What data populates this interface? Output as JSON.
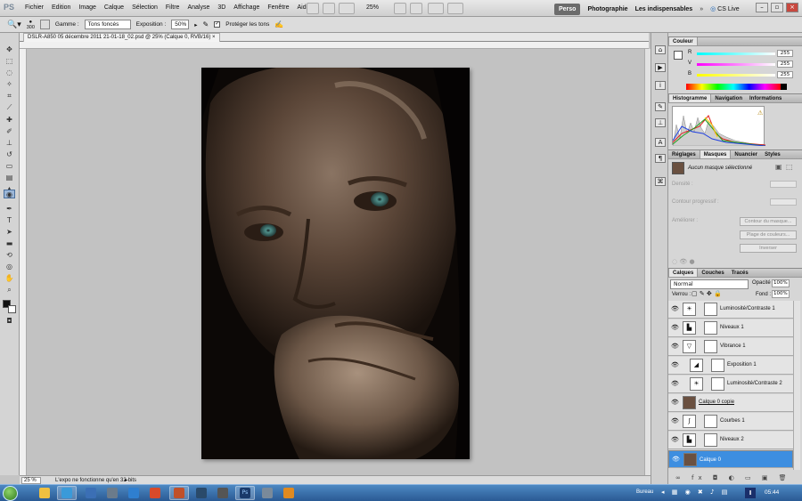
{
  "app": {
    "logo": "PS"
  },
  "menu": [
    "Fichier",
    "Edition",
    "Image",
    "Calque",
    "Sélection",
    "Filtre",
    "Analyse",
    "3D",
    "Affichage",
    "Fenêtre",
    "Aide"
  ],
  "zoom_menu": "25%",
  "workspaces": {
    "active": "Perso",
    "items": [
      "Photographie",
      "Les indispensables"
    ],
    "cslive": "CS Live"
  },
  "options": {
    "brush_size": "300",
    "gamme_label": "Gamme :",
    "gamme_value": "Tons foncés",
    "exposition_label": "Exposition :",
    "exposition_value": "50%",
    "protect_label": "Protéger les tons"
  },
  "document": {
    "tab_title": "DSLR-A850 05 décembre 2011 21-01-18_02.psd @ 25% (Calque 0, RVB/16)"
  },
  "status": {
    "zoom": "25 %",
    "message": "L'expo ne fonctionne qu'en 32-bits"
  },
  "color_panel": {
    "title": "Couleur",
    "channels": [
      {
        "label": "R",
        "value": "255"
      },
      {
        "label": "V",
        "value": "255"
      },
      {
        "label": "B",
        "value": "255"
      }
    ]
  },
  "histogram_panel": {
    "tabs": [
      "Histogramme",
      "Navigation",
      "Informations"
    ]
  },
  "masks_panel": {
    "tabs": [
      "Réglages",
      "Masques",
      "Nuancier",
      "Styles"
    ],
    "no_mask": "Aucun masque sélectionné",
    "density": "Densité :",
    "feather": "Contour progressif :",
    "refine": "Améliorer :",
    "buttons": [
      "Contour du masque...",
      "Plage de couleurs...",
      "Inverser"
    ]
  },
  "layers_panel": {
    "tabs": [
      "Calques",
      "Couches",
      "Tracés"
    ],
    "blend_mode": "Normal",
    "opacity_label": "Opacité :",
    "opacity_value": "100%",
    "lock_label": "Verrou :",
    "fill_label": "Fond :",
    "fill_value": "100%",
    "layers": [
      {
        "name": "Luminosité/Contraste 1",
        "icon": "☀",
        "selected": false
      },
      {
        "name": "Niveaux 1",
        "icon": "▙",
        "selected": false
      },
      {
        "name": "Vibrance 1",
        "icon": "▽",
        "selected": false
      },
      {
        "name": "Exposition 1",
        "icon": "◢",
        "selected": false
      },
      {
        "name": "Luminosité/Contraste 2",
        "icon": "☀",
        "selected": false
      },
      {
        "name": "Calque 0 copie",
        "icon": "",
        "selected": false
      },
      {
        "name": "Courbes 1",
        "icon": "∫",
        "selected": false
      },
      {
        "name": "Niveaux 2",
        "icon": "▙",
        "selected": false
      },
      {
        "name": "Calque 0",
        "icon": "",
        "selected": true
      }
    ]
  },
  "taskbar": {
    "tray_label": "Bureau",
    "clock": "05:44"
  }
}
